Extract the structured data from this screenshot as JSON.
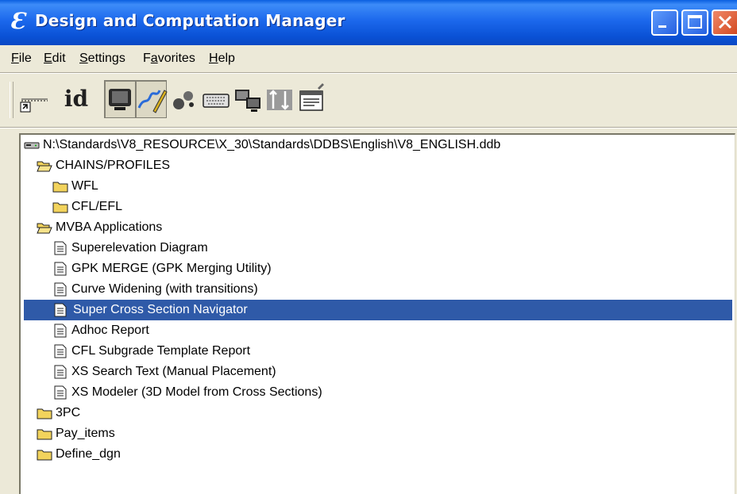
{
  "window": {
    "title": "Design and Computation Manager",
    "app_icon_glyph": "Ɛ",
    "controls": [
      "minimize",
      "maximize",
      "close"
    ]
  },
  "menu": [
    {
      "label": "File",
      "mnemonic": "F"
    },
    {
      "label": "Edit",
      "mnemonic": "E"
    },
    {
      "label": "Settings",
      "mnemonic": "S"
    },
    {
      "label": "Favorites",
      "mnemonic": "a"
    },
    {
      "label": "Help",
      "mnemonic": "H"
    }
  ],
  "toolbar": {
    "tools": [
      {
        "name": "key-in-icon",
        "pressed": false
      },
      {
        "name": "id-icon",
        "label": "id",
        "pressed": false
      },
      {
        "name": "monitor-icon",
        "pressed": true
      },
      {
        "name": "design-pencil-icon",
        "pressed": true
      },
      {
        "name": "bubbles-icon",
        "pressed": false
      },
      {
        "name": "keyboard-icon",
        "pressed": false
      },
      {
        "name": "network-icon",
        "pressed": false
      },
      {
        "name": "sort-icon",
        "pressed": false
      },
      {
        "name": "properties-icon",
        "pressed": false
      }
    ]
  },
  "tree": {
    "root": {
      "label": "N:\\Standards\\V8_RESOURCE\\X_30\\Standards\\DDBS\\English\\V8_ENGLISH.ddb",
      "icon": "drive-icon"
    },
    "nodes": [
      {
        "label": "CHAINS/PROFILES",
        "icon": "open-folder-icon",
        "level": 1
      },
      {
        "label": "WFL",
        "icon": "folder-icon",
        "level": 2
      },
      {
        "label": "CFL/EFL",
        "icon": "folder-icon",
        "level": 2
      },
      {
        "label": "MVBA Applications",
        "icon": "open-folder-icon",
        "level": 1
      },
      {
        "label": "Superelevation Diagram",
        "icon": "document-icon",
        "level": 2
      },
      {
        "label": "GPK MERGE (GPK Merging Utility)",
        "icon": "document-icon",
        "level": 2
      },
      {
        "label": "Curve Widening (with transitions)",
        "icon": "document-icon",
        "level": 2
      },
      {
        "label": "Super Cross Section Navigator",
        "icon": "document-icon",
        "level": 2,
        "selected": true
      },
      {
        "label": "Adhoc Report",
        "icon": "document-icon",
        "level": 2
      },
      {
        "label": "CFL Subgrade Template Report",
        "icon": "document-icon",
        "level": 2
      },
      {
        "label": "XS Search Text (Manual Placement)",
        "icon": "document-icon",
        "level": 2
      },
      {
        "label": "XS Modeler (3D Model from Cross Sections)",
        "icon": "document-icon",
        "level": 2
      },
      {
        "label": "3PC",
        "icon": "folder-icon",
        "level": 1
      },
      {
        "label": "Pay_items",
        "icon": "folder-icon",
        "level": 1
      },
      {
        "label": "Define_dgn",
        "icon": "folder-icon",
        "level": 1
      }
    ]
  },
  "colors": {
    "titlebar": "#0a52d6",
    "selection": "#2f5aa8",
    "window_face": "#ece9d8",
    "folder": "#f2d35c"
  }
}
